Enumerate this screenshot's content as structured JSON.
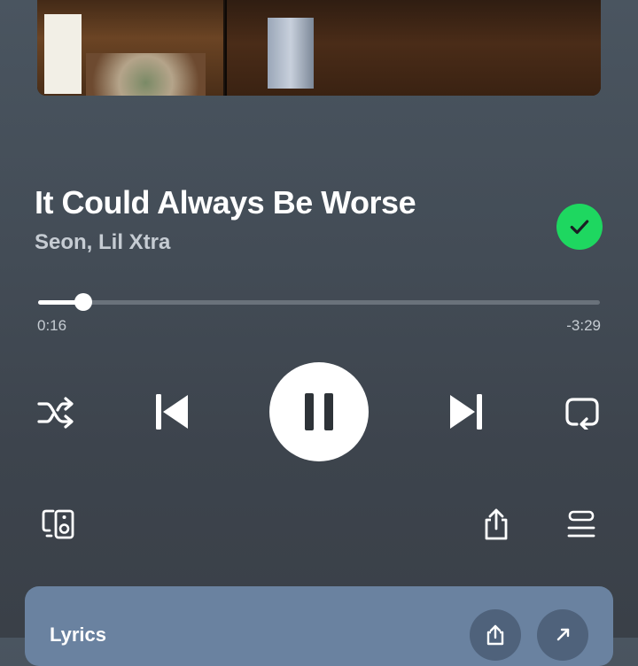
{
  "track": {
    "title": "It Could Always Be Worse",
    "artists": "Seon, Lil Xtra",
    "liked": true
  },
  "progress": {
    "elapsed": "0:16",
    "remaining": "-3:29",
    "fraction": 0.08
  },
  "controls": {
    "shuffle_icon": "shuffle-icon",
    "previous_icon": "skip-previous-icon",
    "play_state": "playing",
    "next_icon": "skip-next-icon",
    "repeat_icon": "repeat-icon"
  },
  "lyrics": {
    "title": "Lyrics"
  },
  "colors": {
    "accent": "#1ed760",
    "background": "#434c56",
    "lyrics_card": "#6a82a0"
  }
}
